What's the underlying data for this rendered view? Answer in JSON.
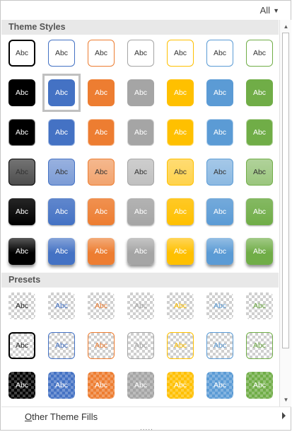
{
  "header": {
    "filter_label": "All",
    "filter_caret_icon": "caret-down-icon"
  },
  "theme_section": {
    "title": "Theme Styles"
  },
  "presets_section": {
    "title": "Presets"
  },
  "cell_label": "Abc",
  "colors": {
    "dark": "#000000",
    "blue": "#4472c4",
    "orange": "#ed7d31",
    "gray": "#a5a5a5",
    "gold": "#ffc000",
    "lightblue": "#5b9bd5",
    "green": "#70ad47"
  },
  "theme_rows": [
    {
      "style": "outline",
      "cells": [
        "dark",
        "blue",
        "orange",
        "gray",
        "gold",
        "lightblue",
        "green"
      ]
    },
    {
      "style": "solid",
      "cells": [
        "dark",
        "blue",
        "orange",
        "gray",
        "gold",
        "lightblue",
        "green"
      ],
      "selected_index": 1
    },
    {
      "style": "solid-light-border",
      "cells": [
        "dark",
        "blue",
        "orange",
        "gray",
        "gold",
        "lightblue",
        "green"
      ]
    },
    {
      "style": "tint",
      "cells": [
        "dark",
        "blue",
        "orange",
        "gray",
        "gold",
        "lightblue",
        "green"
      ]
    },
    {
      "style": "gradient",
      "cells": [
        "dark",
        "blue",
        "orange",
        "gray",
        "gold",
        "lightblue",
        "green"
      ]
    },
    {
      "style": "intense",
      "cells": [
        "dark",
        "blue",
        "orange",
        "gray",
        "gold",
        "lightblue",
        "green"
      ]
    }
  ],
  "preset_rows": [
    {
      "style": "transparent",
      "cells": [
        "dark",
        "blue",
        "orange",
        "gray",
        "gold",
        "lightblue",
        "green"
      ]
    },
    {
      "style": "transparent-outline",
      "cells": [
        "dark",
        "blue",
        "orange",
        "gray",
        "gold",
        "lightblue",
        "green"
      ]
    },
    {
      "style": "semi-transparent",
      "cells": [
        "dark",
        "blue",
        "orange",
        "gray",
        "gold",
        "lightblue",
        "green"
      ]
    }
  ],
  "footer": {
    "other_fills_label_prefix": "O",
    "other_fills_label_rest": "ther Theme Fills",
    "submenu_icon": "chevron-right-icon",
    "grip_icon": "resize-grip-icon",
    "grip_text": "....."
  },
  "scrollbar": {
    "up_icon": "scroll-up-icon",
    "down_icon": "scroll-down-icon",
    "up_glyph": "▲",
    "down_glyph": "▼"
  }
}
